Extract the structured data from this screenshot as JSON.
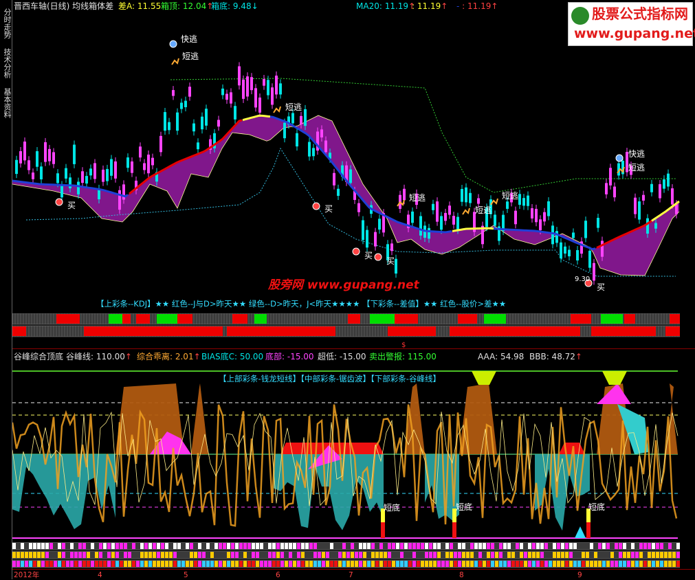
{
  "side_tabs": [
    "分时走势",
    "技术分析",
    "基本资料"
  ],
  "upper": {
    "title": "晋西车轴(日线) 均线箱体差",
    "diff_label": "差A: 11.55",
    "box_top_label": "箱顶: 12.04",
    "box_bottom_label": "箱底: 9.48",
    "ma20_label": "MA20: 11.19",
    "v2": ": 11.19",
    "v3": ": 11.19",
    "annot_kuaitao": "快逃",
    "annot_duantao": "短逃",
    "annot_mai": "买",
    "price_low": "9.30",
    "watermark_center": "股旁网 www.gupang.net",
    "legend": "【上彩条--KDJ】★★ 红色--J与D>昨天★★ 绿色--D>昨天，J<昨天★★★★   【下彩条--差值】★★ 红色--股价>差★★"
  },
  "lower": {
    "title": "谷峰综合顶底",
    "gufeng_label": "谷峰线: 110.00",
    "zonghe_label": "综合乖离: 2.01",
    "bias_label": "BIAS底C: 50.00",
    "dibu_label": "底部: -15.00",
    "chaodi_label": "超低: -15.00",
    "maichu_label": "卖出警报: 115.00",
    "aaa_label": "AAA: 54.98",
    "bbb_label": "BBB: 48.72",
    "legend": "【上部彩条-钱龙短线】【中部彩条-锯齿波】【下部彩条-谷峰线】",
    "annot_duandi": "短底",
    "axis_labels": [
      "2012年",
      "4",
      "5",
      "6",
      "7",
      "8",
      "9"
    ],
    "axis_marker": "$"
  },
  "watermark": {
    "line1": "股票公式指标网",
    "line2": "www.gupang.net"
  },
  "colors": {
    "background": "#000000",
    "up_candle": "#ff44ff",
    "down_candle": "#00e5e5",
    "ma_blue": "#1f3fd6",
    "ma_red": "#e60000",
    "ma_yellow": "#ffff44",
    "cloud": "#8e1a9a",
    "title_red": "#ff4040",
    "gupang_red": "#ee1111"
  },
  "chart_data": {
    "type": "candlestick",
    "title": "晋西车轴(日线)",
    "ylim": [
      9.0,
      13.3
    ],
    "x": [
      "2012年",
      "4",
      "5",
      "6",
      "7",
      "8",
      "9"
    ],
    "series": [
      {
        "name": "MA20",
        "values": [
          11.19
        ]
      },
      {
        "name": "箱顶",
        "values": [
          12.04
        ]
      },
      {
        "name": "箱底",
        "values": [
          9.48
        ]
      }
    ]
  }
}
